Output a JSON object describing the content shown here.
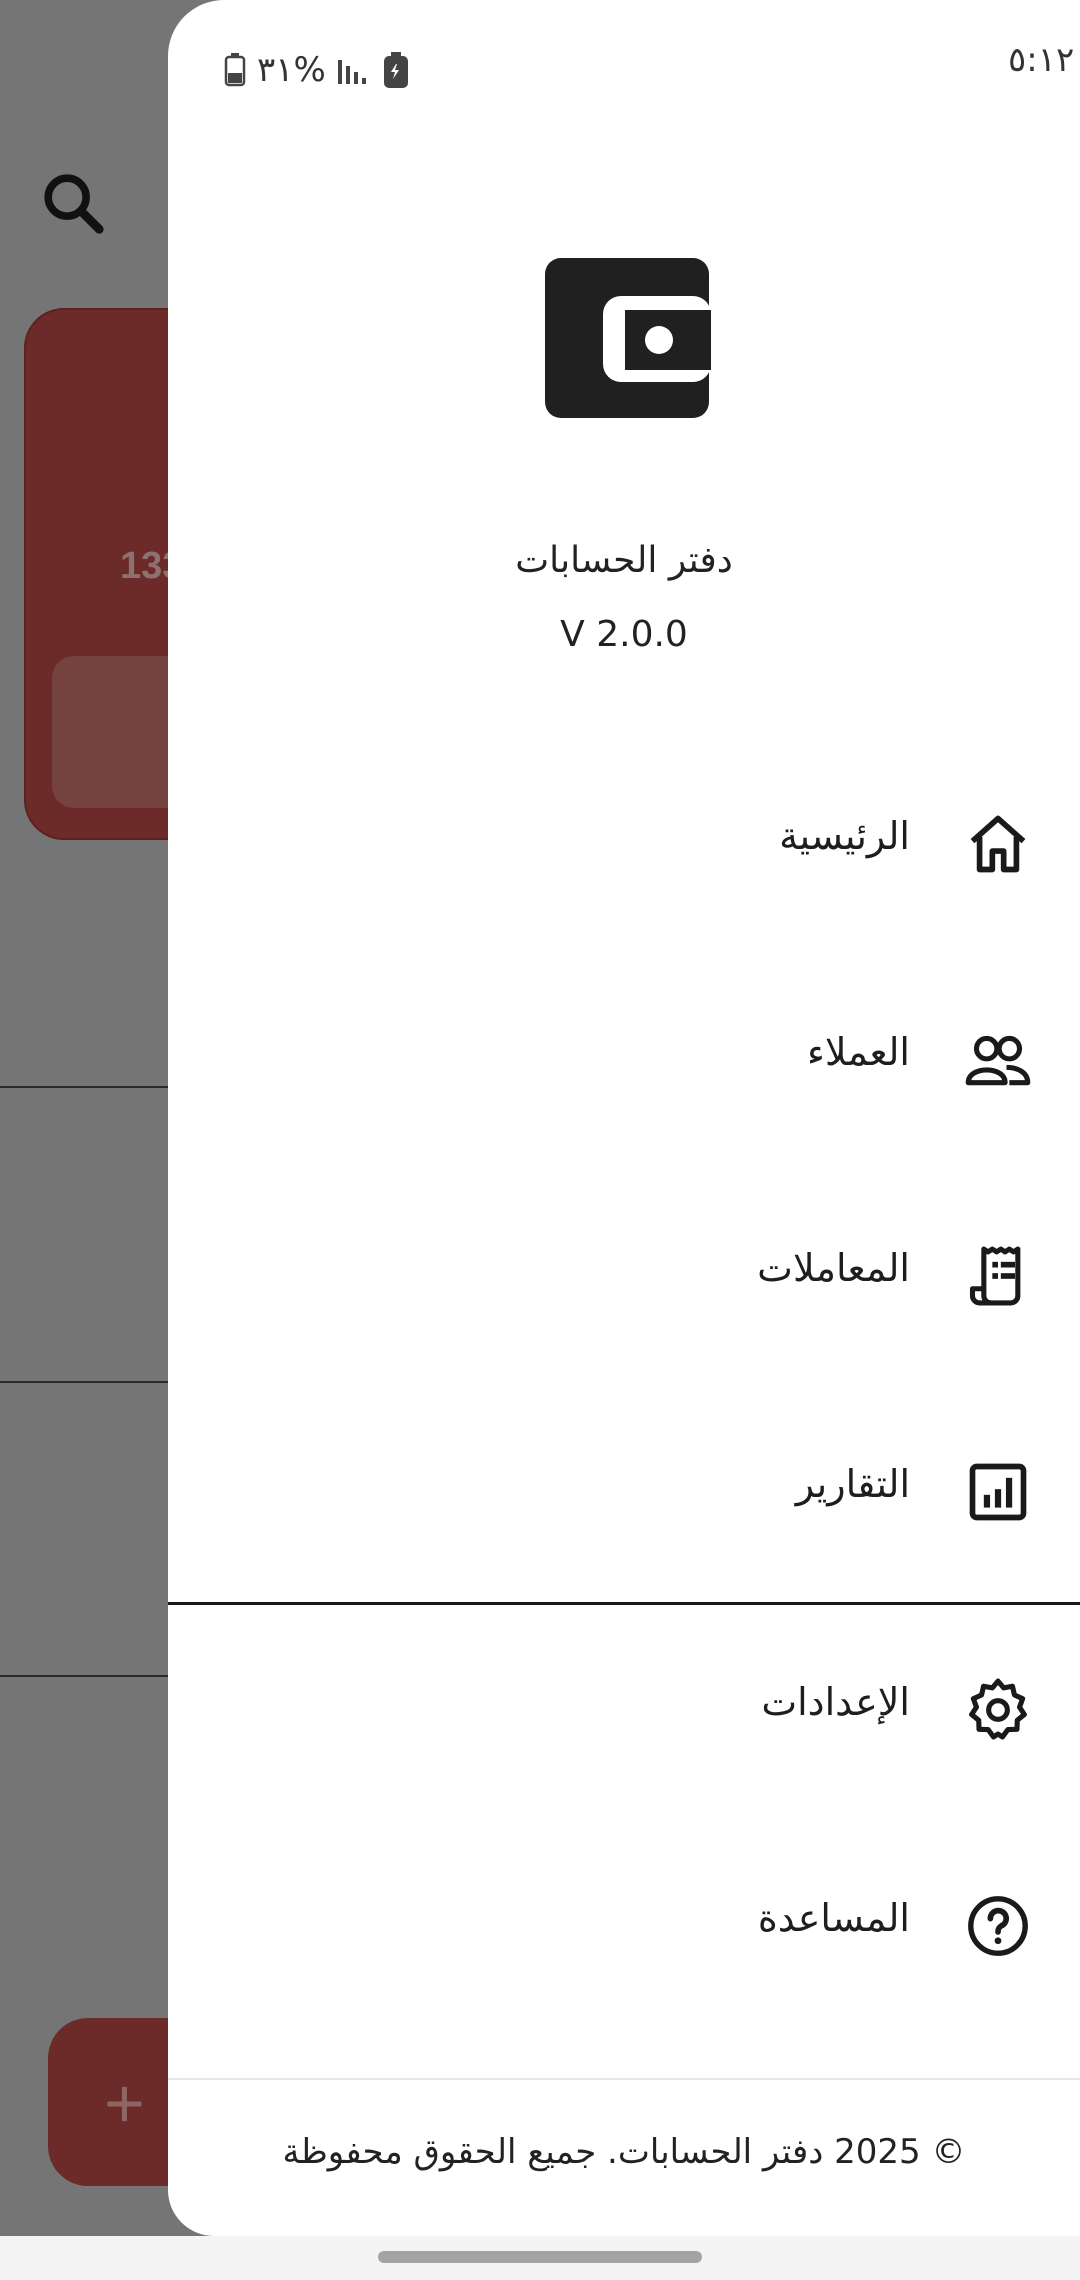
{
  "status_bar": {
    "time": "٥:١٢",
    "battery_percent": "٣١%"
  },
  "background": {
    "card_amount_partial": "133",
    "fab_label": "+"
  },
  "drawer": {
    "app_name": "دفتر الحسابات",
    "version": "V 2.0.0",
    "menu": [
      {
        "label": "الرئيسية",
        "icon": "home-icon"
      },
      {
        "label": "العملاء",
        "icon": "people-icon"
      },
      {
        "label": "المعاملات",
        "icon": "receipt-icon"
      },
      {
        "label": "التقارير",
        "icon": "report-chart-icon"
      },
      {
        "label": "الإعدادات",
        "icon": "gear-icon"
      },
      {
        "label": "المساعدة",
        "icon": "help-icon"
      }
    ],
    "footer": "© 2025 دفتر الحسابات. جميع الحقوق محفوظة"
  },
  "colors": {
    "card_red": "#6c2a28",
    "scrim": "#757575",
    "drawer_bg": "#ffffff",
    "text": "#1e1e1e"
  }
}
